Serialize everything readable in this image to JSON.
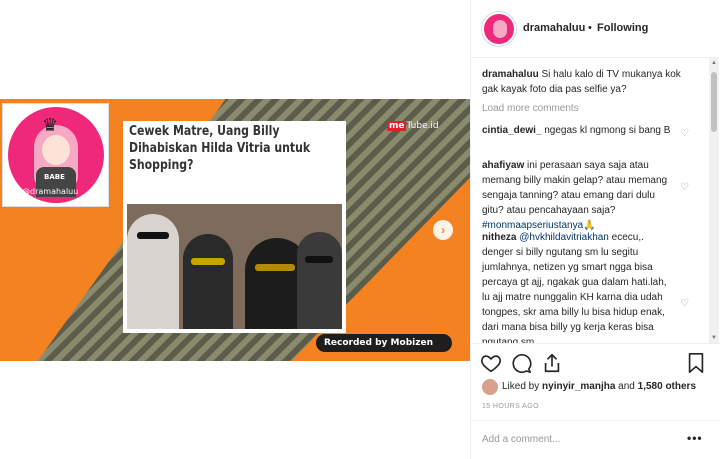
{
  "post": {
    "avatar_handle": "@dramahaluu",
    "avatar_tag": "BABE",
    "news_title": "Cewek Matre, Uang Billy Dihabiskan Hilda Vitria untuk Shopping?",
    "tube_logo_me": "me",
    "tube_logo_rest": "Tube.id",
    "recorded_label": "Recorded by Mobizen",
    "next_label": "›"
  },
  "header": {
    "username": "dramahaluu",
    "separator": "•",
    "follow_status": "Following"
  },
  "caption": {
    "user": "dramahaluu",
    "text": "Si halu kalo di TV mukanya kok gak kayak foto dia pas selfie ya?"
  },
  "load_more": "Load more comments",
  "comments": [
    {
      "user": "cintia_dewi_",
      "text": "ngegas kl ngmong si bang B"
    },
    {
      "user": "ahafiyaw",
      "text": "ini perasaan saya saja atau memang billy makin gelap? atau memang sengaja tanning? atau emang dari dulu gitu? atau pencahayaan saja?",
      "hashtag": "#monmaapseriustanya",
      "emoji": "🙏"
    },
    {
      "user": "nitheza",
      "mention": "@hvkhildavitriakhan",
      "text": "ececu,. denger si billy ngutang sm lu segitu jumlahnya, netizen yg smart ngga bisa percaya gt ajj, ngakak gua dalam hati.lah, lu ajj matre nunggalin KH karna dia udah tongpes, skr ama billy lu bisa hidup enak, dari mana bisa billy yg kerja keras bisa ngutang sm"
    }
  ],
  "likes": {
    "prefix": "Liked by",
    "user": "nyinyir_manjha",
    "conjunction": "and",
    "others": "1,580 others"
  },
  "timestamp": "15 HOURS AGO",
  "add_comment": {
    "placeholder": "Add a comment...",
    "more": "•••"
  },
  "icons": [
    "heart-icon",
    "comment-icon",
    "share-icon",
    "bookmark-icon"
  ]
}
